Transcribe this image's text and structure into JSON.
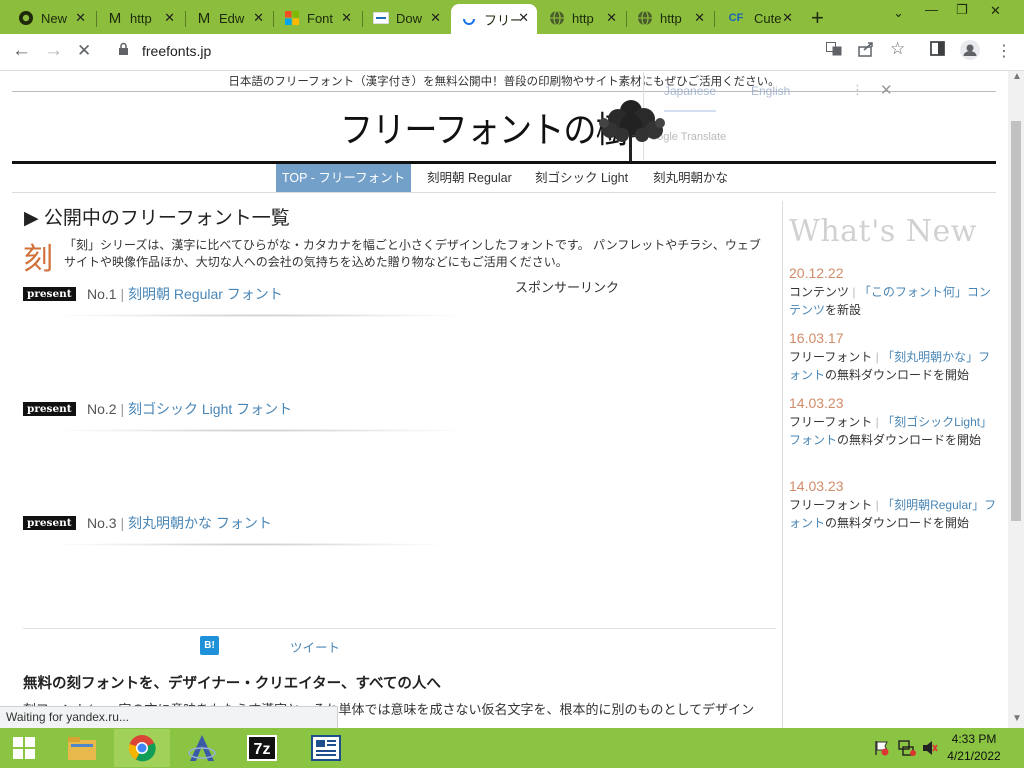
{
  "browser": {
    "tabs": [
      {
        "label": "New",
        "icon": "chrome-icon"
      },
      {
        "label": "http",
        "icon": "gmail-icon"
      },
      {
        "label": "Edw",
        "icon": "gmail-icon"
      },
      {
        "label": "Font",
        "icon": "microsoft-icon"
      },
      {
        "label": "Dow",
        "icon": "fontfree-icon"
      },
      {
        "label": "フリー",
        "icon": "loading-icon",
        "active": true
      },
      {
        "label": "http",
        "icon": "globe-icon"
      },
      {
        "label": "http",
        "icon": "globe-icon"
      },
      {
        "label": "Cute",
        "icon": "cf-icon"
      }
    ],
    "cf_glyph": "CF",
    "gmail_glyph": "M",
    "new_tab_glyph": "+",
    "address": "freefonts.jp",
    "status_text": "Waiting for yandex.ru..."
  },
  "page": {
    "top_notice": "日本語のフリーフォント（漢字付き）を無料公開中！普段の印刷物やサイト素材にもぜひご活用ください。",
    "logo_text": "フリーフォントの樹",
    "translate": {
      "japanese": "Japanese",
      "english": "English",
      "google": "oogle Translate"
    },
    "menu": [
      {
        "label": "TOP - フリーフォント",
        "active": true
      },
      {
        "label": "刻明朝 Regular"
      },
      {
        "label": "刻ゴシック Light"
      },
      {
        "label": "刻丸明朝かな"
      }
    ],
    "section_title": "▶ 公開中のフリーフォント一覧",
    "koku_char": "刻",
    "intro_text": "「刻」シリーズは、漢字に比べてひらがな・カタカナを幅ごと小さくデザインしたフォントです。 パンフレットやチラシ、ウェブサイトや映像作品ほか、大切な人への会社の気持ちを込めた贈り物などにもご活用ください。",
    "sponsor": "スポンサーリンク",
    "present_label": "present",
    "presents": [
      {
        "no": "No.1",
        "sep": "|",
        "link": "刻明朝 Regular フォント"
      },
      {
        "no": "No.2",
        "sep": "|",
        "link": "刻ゴシック Light フォント"
      },
      {
        "no": "No.3",
        "sep": "|",
        "link": "刻丸明朝かな フォント"
      }
    ],
    "hatena": "B!",
    "tweet": "ツイート",
    "bottom_heading": "無料の刻フォントを、デザイナー・クリエイター、すべての人へ",
    "bottom_text": "刻フォント(…　宮の文に意味をもたらす漢字と、それ単体では意味を成さない仮名文字を、根本的に別のものとしてデザイン"
  },
  "whats_new": {
    "title": "What's New",
    "items": [
      {
        "date": "20.12.22",
        "cat": "コンテンツ",
        "link": "「このフォント何」コ",
        "link2": "ンテンツ",
        "rest": "を新設"
      },
      {
        "date": "16.03.17",
        "cat": "フリーフォント",
        "link": "「刻丸明朝かな」",
        "link2": "フォント",
        "rest": "の無料ダウンロードを開始"
      },
      {
        "date": "14.03.23",
        "cat": "フリーフォント",
        "link": "「刻ゴシック",
        "link2": "Light」フォント",
        "rest": "の無料ダウンロードを開始"
      },
      {
        "date": "14.03.23",
        "cat": "フリーフォント",
        "link": "「刻明朝",
        "link2": "Regular」フォント",
        "rest": "の無料ダウンロードを開始"
      }
    ]
  },
  "taskbar": {
    "apps": [
      "file-explorer-icon",
      "chrome-icon",
      "app-a-icon",
      "7zip-icon",
      "news-app-icon"
    ],
    "sevenzip_label": "7z",
    "time": "4:33 PM",
    "date": "4/21/2022"
  },
  "colors": {
    "tabbar": "#8cbd3c",
    "taskbar": "#8bc342",
    "menu_active": "#73a0c8",
    "link": "#4a86b5",
    "news_date": "#d18c6a",
    "koku": "#d2703a"
  }
}
